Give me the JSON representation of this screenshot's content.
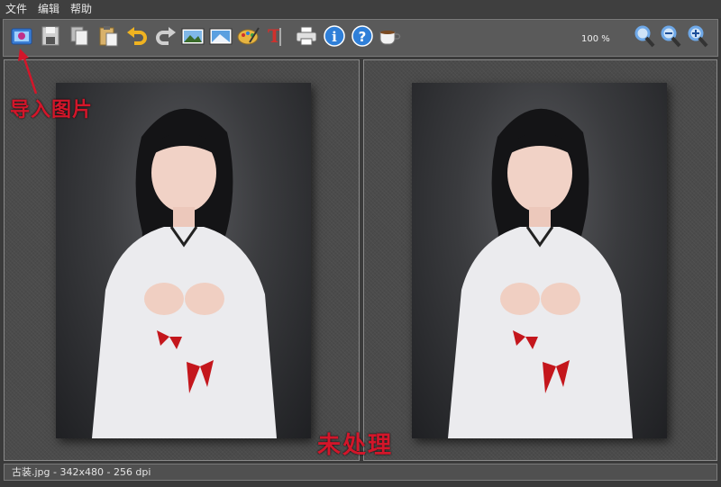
{
  "menu": {
    "items": [
      "文件",
      "编辑",
      "帮助"
    ]
  },
  "toolbar": {
    "zoom_label": "100 %",
    "buttons": [
      {
        "name": "open-image-icon",
        "color": "#3b7fd6"
      },
      {
        "name": "save-icon",
        "color": "#cfcfcf"
      },
      {
        "name": "copy-icon",
        "color": "#e8e8e8"
      },
      {
        "name": "paste-icon",
        "color": "#d9b26b"
      },
      {
        "name": "undo-icon",
        "color": "#f0b320"
      },
      {
        "name": "redo-icon",
        "color": "#cfcfcf"
      },
      {
        "name": "image-adjust-icon",
        "color": "#5aa0e0"
      },
      {
        "name": "image-effect-icon",
        "color": "#5aa0e0"
      },
      {
        "name": "palette-icon",
        "color": "#e7b440"
      },
      {
        "name": "text-icon",
        "color": "#d0312d"
      },
      {
        "name": "print-icon",
        "color": "#e0e0e0"
      },
      {
        "name": "info-icon",
        "color": "#2f7fd8"
      },
      {
        "name": "help-icon",
        "color": "#2f7fd8"
      },
      {
        "name": "coffee-icon",
        "color": "#f2f2f2"
      },
      {
        "name": "zoom-icon",
        "color": "#6ea8e8"
      },
      {
        "name": "zoom-out-icon",
        "color": "#6ea8e8"
      },
      {
        "name": "zoom-in-icon",
        "color": "#6ea8e8"
      }
    ]
  },
  "annotations": {
    "import": "导入图片",
    "unprocessed": "未处理"
  },
  "status": {
    "text": "古装.jpg - 342x480 - 256 dpi"
  },
  "colors": {
    "accent": "#d3162a",
    "background": "#3a3a3a"
  }
}
